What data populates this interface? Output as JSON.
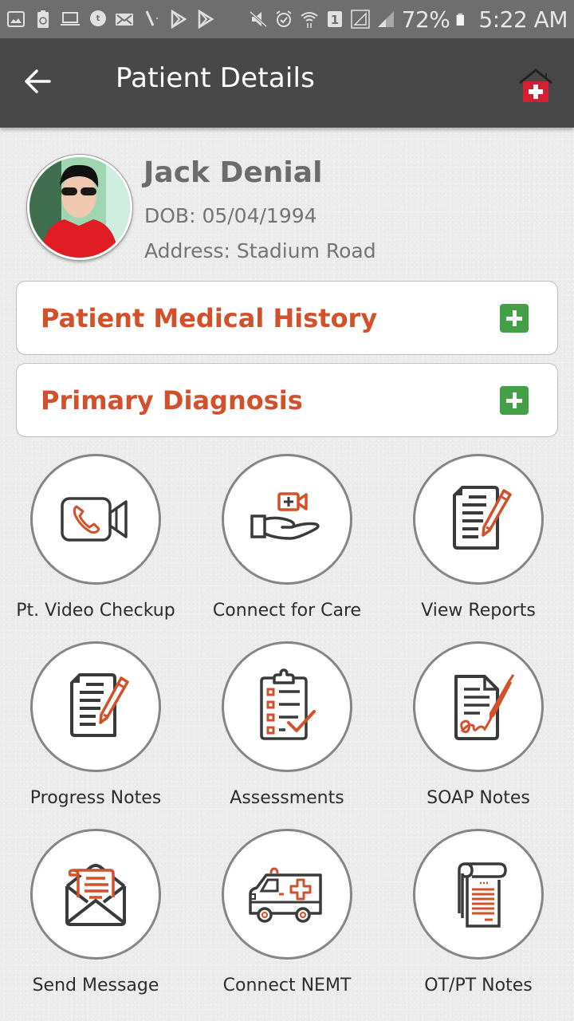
{
  "status_bar": {
    "notification_icons": [
      "gallery-icon",
      "recycle-battery-icon",
      "laptop-icon",
      "tumblr-mail-icon",
      "email-icon",
      "pen-icon",
      "play-store-icon",
      "play-store-icon"
    ],
    "system_icons": [
      "mute-icon",
      "alarm-icon",
      "wifi-icon",
      "sim-1-icon",
      "signal-icon",
      "signal-icon"
    ],
    "battery": "72%",
    "time": "5:22 AM"
  },
  "app_bar": {
    "title": "Patient Details",
    "back_icon": "arrow-left-icon",
    "home_icon": "medical-home-icon"
  },
  "patient": {
    "name": "Jack Denial",
    "dob": "DOB: 05/04/1994",
    "address": "Address: Stadium Road"
  },
  "sections": [
    {
      "label": "Patient Medical History",
      "action_icon": "plus-icon"
    },
    {
      "label": "Primary Diagnosis",
      "action_icon": "plus-icon"
    }
  ],
  "actions": [
    {
      "label": "Pt. Video Checkup",
      "icon": "video-call-icon"
    },
    {
      "label": "Connect for Care",
      "icon": "hand-video-icon"
    },
    {
      "label": "View Reports",
      "icon": "document-pencil-icon"
    },
    {
      "label": "Progress Notes",
      "icon": "document-pencil-icon"
    },
    {
      "label": "Assessments",
      "icon": "clipboard-check-icon"
    },
    {
      "label": "SOAP Notes",
      "icon": "document-signature-icon"
    },
    {
      "label": "Send Message",
      "icon": "envelope-letter-icon"
    },
    {
      "label": "Connect NEMT",
      "icon": "ambulance-icon"
    },
    {
      "label": "OT/PT Notes",
      "icon": "scroll-notes-icon"
    }
  ],
  "colors": {
    "accent": "#d2502a",
    "add_button": "#43a047",
    "app_bar": "#484848",
    "status_bar": "#6e6e6e",
    "icon_dark": "#3a3a3a"
  }
}
